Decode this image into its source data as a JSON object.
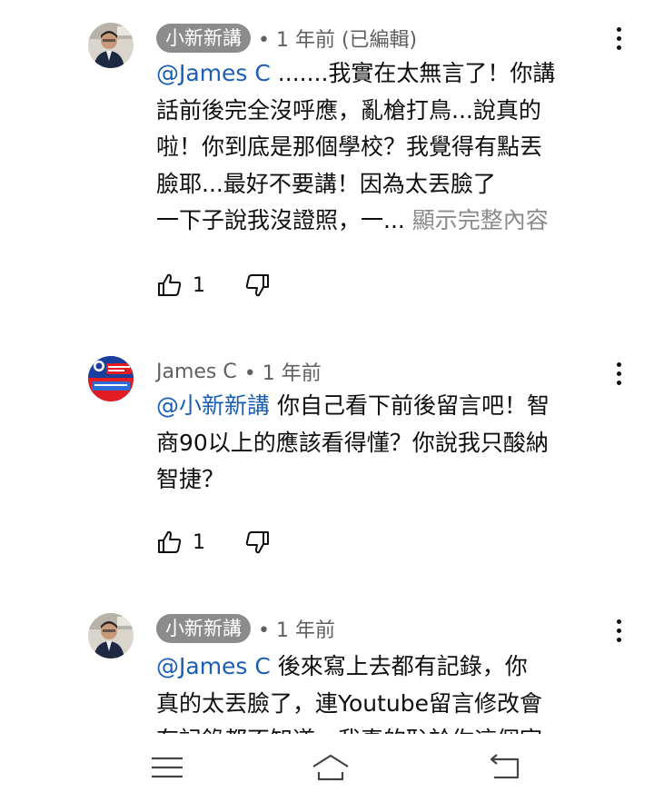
{
  "comments": [
    {
      "author": "小新新講",
      "author_style": "chip",
      "meta": "• 1 年前 (已編輯)",
      "lines": [
        {
          "mention": "@James C",
          "text": " .......我實在太無言了！你講"
        },
        {
          "mention": "",
          "text": "話前後完全沒呼應，亂槍打鳥...說真的"
        },
        {
          "mention": "",
          "text": "啦！你到底是那個學校？我覺得有點丟"
        },
        {
          "mention": "",
          "text": "臉耶...最好不要講！因為太丟臉了"
        },
        {
          "mention": "",
          "text": "一下子說我沒證照，一... ",
          "show_more": "顯示完整內容"
        }
      ],
      "likes": "1"
    },
    {
      "author": "James C",
      "author_style": "plain",
      "meta": "• 1 年前",
      "lines": [
        {
          "mention": "@小新新講",
          "text": " 你自己看下前後留言吧！智"
        },
        {
          "mention": "",
          "text": "商90以上的應該看得懂？你說我只酸納"
        },
        {
          "mention": "",
          "text": "智捷？"
        }
      ],
      "likes": "1"
    },
    {
      "author": "小新新講",
      "author_style": "chip",
      "meta": "• 1 年前",
      "lines": [
        {
          "mention": "@James C",
          "text": " 後來寫上去都有記錄，你"
        },
        {
          "mention": "",
          "text": "真的太丟臉了，連Youtube留言修改會"
        },
        {
          "mention": "",
          "text": "有記錄都不知道，我真的恥於你這個官"
        }
      ],
      "likes": ""
    }
  ],
  "icons": {
    "like": "thumb-up-icon",
    "dislike": "thumb-down-icon",
    "more": "more-vertical-icon",
    "nav_menu": "menu-icon",
    "nav_home": "home-icon",
    "nav_back": "back-icon"
  },
  "colors": {
    "mention": "#1a5fb4",
    "author_chip": "#8c8c8c",
    "meta": "#606060",
    "show_more": "#8a8a8a"
  }
}
